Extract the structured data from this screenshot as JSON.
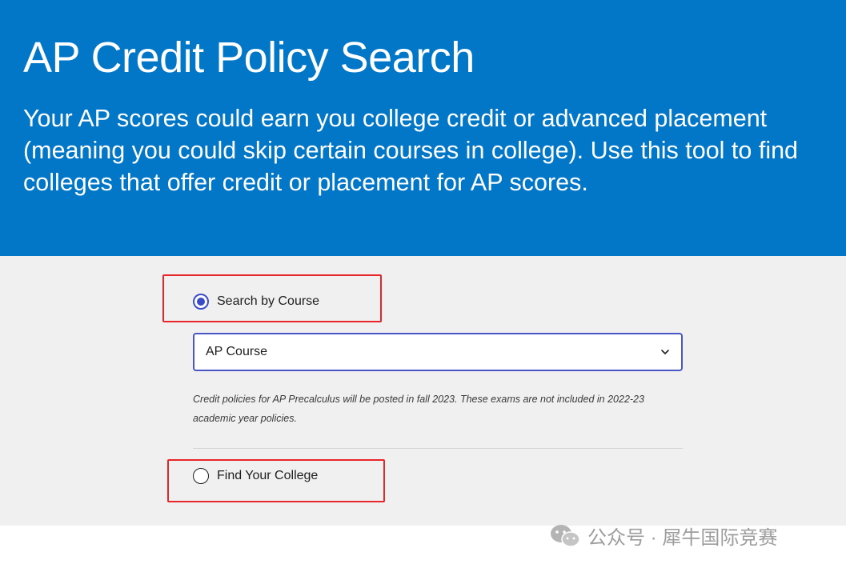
{
  "header": {
    "title": "AP Credit Policy Search",
    "description": "Your AP scores could earn you college credit or advanced placement (meaning you could skip certain courses in college). Use this tool to find colleges that offer credit or placement for AP scores."
  },
  "search_options": {
    "by_course": {
      "label": "Search by Course",
      "selected": true
    },
    "course_select": {
      "value": "AP Course",
      "icon": "chevron-down-icon"
    },
    "note": "Credit policies for AP Precalculus will be posted in fall 2023. These exams are not included in 2022-23 academic year policies.",
    "find_college": {
      "label": "Find Your College",
      "selected": false
    }
  },
  "watermark": {
    "text": "公众号 · 犀牛国际竞赛",
    "icon": "wechat-icon"
  },
  "colors": {
    "header_bg": "#0277c8",
    "panel_bg": "#f0f0f0",
    "accent": "#3b4bc8",
    "highlight": "#e8262a"
  }
}
